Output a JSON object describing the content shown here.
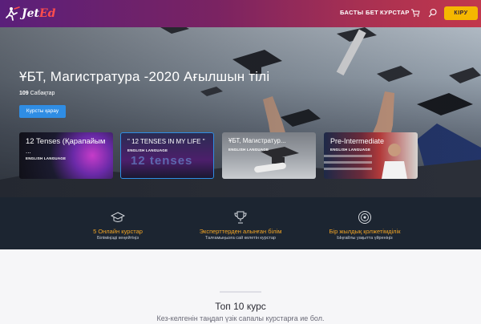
{
  "nav": {
    "logo_text_main": "Jet",
    "logo_text_accent": "Ed",
    "links": [
      "БАСТЫ БЕТ",
      "КУРСТАР"
    ],
    "login_label": "КІРУ",
    "icons": [
      "cart-icon",
      "search-icon"
    ],
    "colors": {
      "gradient_start": "#5a1f7a",
      "gradient_end": "#c2384c",
      "login_bg": "#f5b700"
    }
  },
  "hero": {
    "title": "ҰБТ, Магистратура -2020 Ағылшын тілі",
    "lesson_count": "109",
    "lesson_label": "Сабақтар",
    "button_label": "Курсты қарау",
    "button_color": "#2f8de4"
  },
  "cards": [
    {
      "title": "12 Tenses (Қарапайым",
      "extra": "...",
      "subtitle": "ENGLISH LANGUAGE"
    },
    {
      "title": "\" 12 TENSES IN MY LIFE \"",
      "subtitle": "ENGLISH LANGUAGE",
      "image_text": "12 tenses"
    },
    {
      "title": "ҰБТ, Магистратур...",
      "subtitle": "ENGLISH LANGUAGE"
    },
    {
      "title": "Pre-Intermediate",
      "subtitle": "ENGLISH LANGUAGE"
    }
  ],
  "features": [
    {
      "icon": "graduation-cap-icon",
      "title": "5 Онлайн курстар",
      "subtitle": "Біліміңізді кеңейтіңіз"
    },
    {
      "icon": "trophy-icon",
      "title": "Эксперттерден алынған білім",
      "subtitle": "Талғамыңызға сай келетін курстар"
    },
    {
      "icon": "target-icon",
      "title": "Бір жылдық қолжетімділік",
      "subtitle": "Ыңғайлы уақытта үйреніңіз"
    }
  ],
  "features_accent": "#f5a623",
  "section": {
    "title": "Топ 10 курс",
    "subtitle": "Кез-келгенін таңдап үзік сапалы курстарға ие бол."
  }
}
